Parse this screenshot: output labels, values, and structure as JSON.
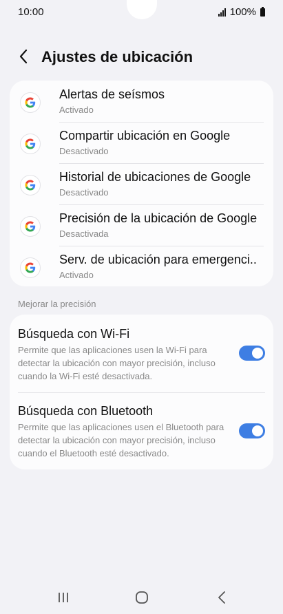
{
  "status": {
    "time": "10:00",
    "battery": "100%"
  },
  "header": {
    "title": "Ajustes de ubicación"
  },
  "apps": [
    {
      "title": "Alertas de seísmos",
      "status": "Activado"
    },
    {
      "title": "Compartir ubicación en Google",
      "status": "Desactivado"
    },
    {
      "title": "Historial de ubicaciones de Google",
      "status": "Desactivado"
    },
    {
      "title": "Precisión de la ubicación de Google",
      "status": "Desactivada"
    },
    {
      "title": "Serv. de ubicación para emergenci..",
      "status": "Activado"
    }
  ],
  "section": {
    "label": "Mejorar la precisión"
  },
  "toggles": [
    {
      "title": "Búsqueda con Wi-Fi",
      "desc": "Permite que las aplicaciones usen la Wi-Fi para detectar la ubicación con mayor precisión, incluso cuando la Wi-Fi esté desactivada.",
      "enabled": true
    },
    {
      "title": "Búsqueda con Bluetooth",
      "desc": "Permite que las aplicaciones usen el Bluetooth para detectar la ubicación con mayor precisión, incluso cuando el Bluetooth esté desactivado.",
      "enabled": true
    }
  ],
  "colors": {
    "accent": "#3e7ee3",
    "background": "#f2f2f6",
    "card": "#fcfcfd"
  },
  "icons": {
    "back": "chevron-left-icon",
    "google": "google-g-icon",
    "recents": "recents-icon",
    "home": "home-icon",
    "nav_back": "back-icon"
  }
}
